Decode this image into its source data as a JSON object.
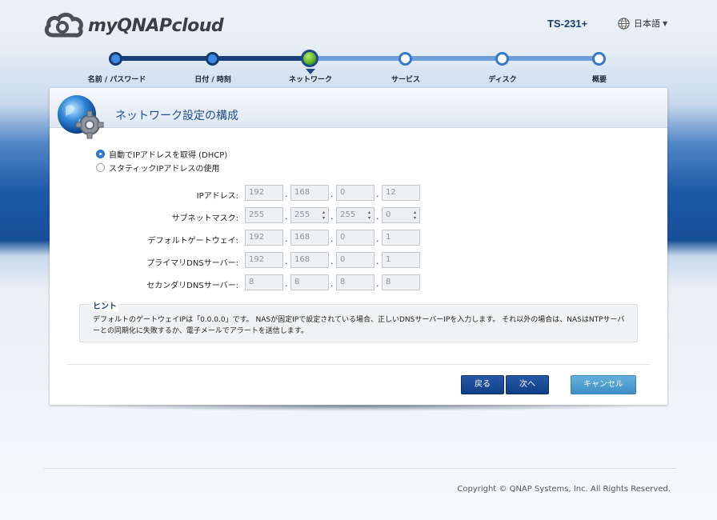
{
  "header": {
    "logo_text": "myQNAPcloud",
    "model": "TS-231+",
    "language": "日本語"
  },
  "steps": [
    {
      "label": "名前 / パスワード",
      "state": "done"
    },
    {
      "label": "日付 / 時刻",
      "state": "done"
    },
    {
      "label": "ネットワーク",
      "state": "current"
    },
    {
      "label": "サービス",
      "state": "todo"
    },
    {
      "label": "ディスク",
      "state": "todo"
    },
    {
      "label": "概要",
      "state": "todo"
    }
  ],
  "panel": {
    "title": "ネットワーク設定の構成",
    "radio_dhcp": "自動でIPアドレスを取得 (DHCP)",
    "radio_static": "スタティックIPアドレスの使用",
    "selected_mode": "dhcp",
    "fields": {
      "ip": {
        "label": "IPアドレス:",
        "values": [
          "192",
          "168",
          "0",
          "12"
        ]
      },
      "mask": {
        "label": "サブネットマスク:",
        "values": [
          "255",
          "255",
          "255",
          "0"
        ]
      },
      "gateway": {
        "label": "デフォルトゲートウェイ:",
        "values": [
          "192",
          "168",
          "0",
          "1"
        ]
      },
      "dns1": {
        "label": "プライマリDNSサーバー:",
        "values": [
          "192",
          "168",
          "0",
          "1"
        ]
      },
      "dns2": {
        "label": "セカンダリDNSサーバー:",
        "values": [
          "8",
          "8",
          "8",
          "8"
        ]
      }
    },
    "hint_title": "ヒント",
    "hint_text": "デフォルトのゲートウェイIPは「0.0.0.0」です。 NASが固定IPで設定されている場合、正しいDNSサーバーIPを入力します。 それ以外の場合は、NASはNTPサーバーとの同期化に失敗するか、電子メールでアラートを送信します。",
    "buttons": {
      "back": "戻る",
      "next": "次へ",
      "cancel": "キャンセル"
    }
  },
  "footer": {
    "copyright": "Copyright © QNAP Systems, Inc. All Rights Reserved."
  },
  "colors": {
    "accent_dark": "#1a3f78",
    "accent_light": "#6f9fd8",
    "current_step": "#4ea21a",
    "title_blue": "#1f4d8c"
  }
}
